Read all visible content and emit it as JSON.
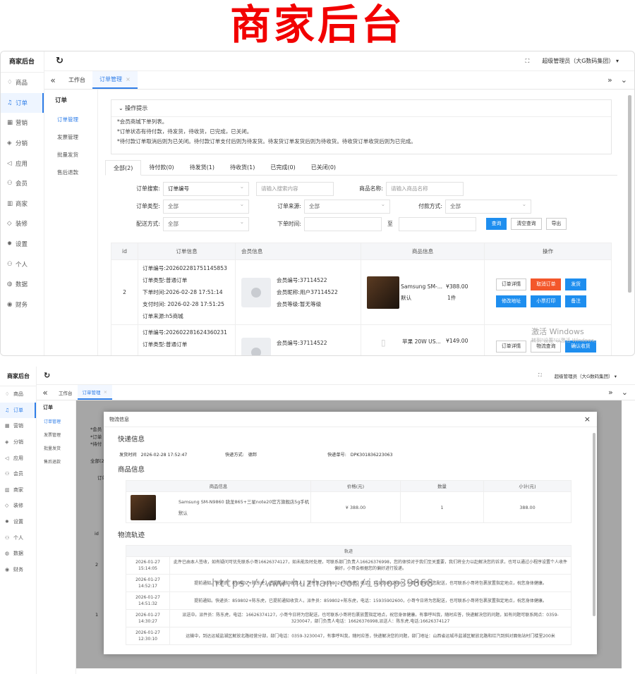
{
  "banner_title": "商家后台",
  "brand": "商家后台",
  "nav": [
    {
      "label": "商品",
      "icon": "diamond-icon"
    },
    {
      "label": "订单",
      "icon": "bell-icon",
      "active": true
    },
    {
      "label": "营销",
      "icon": "chart-icon"
    },
    {
      "label": "分销",
      "icon": "layers-icon"
    },
    {
      "label": "应用",
      "icon": "send-icon"
    },
    {
      "label": "会员",
      "icon": "user-icon"
    },
    {
      "label": "商家",
      "icon": "shop-icon"
    },
    {
      "label": "装修",
      "icon": "tag-icon"
    },
    {
      "label": "设置",
      "icon": "gear-icon"
    },
    {
      "label": "个人",
      "icon": "person-icon"
    },
    {
      "label": "数据",
      "icon": "globe-icon"
    },
    {
      "label": "财务",
      "icon": "money-icon"
    }
  ],
  "nav_icons": [
    "♢",
    "♫",
    "▦",
    "◈",
    "◁",
    "⚇",
    "▥",
    "◇",
    "✹",
    "⚇",
    "◍",
    "◉"
  ],
  "user": "超级管理员（大G数码集团）",
  "tabs": {
    "home": "工作台",
    "current": "订单管理",
    "close": "×"
  },
  "sub": {
    "heading": "订单",
    "items": [
      "订单管理",
      "发票管理",
      "批量发货",
      "售后退款"
    ]
  },
  "tips": {
    "title": "操作提示",
    "lines": [
      "*会员商城下单列表。",
      "*订单状态有待付款，待发货，待收货，已完成，已关闭。",
      "*待付款订单取消后则为已关闭。待付款订单支付后则为待发货。待发货订单发货后则为待收货。待收货订单收货后则为已完成。"
    ]
  },
  "status_tabs": [
    "全部(2)",
    "待付款(0)",
    "待发货(1)",
    "待收货(1)",
    "已完成(0)",
    "已关闭(0)"
  ],
  "filters": {
    "search_label": "订单搜索:",
    "search_type": "订单编号",
    "search_placeholder": "请输入搜索内容",
    "goods_label": "商品名称:",
    "goods_placeholder": "请输入商品名称",
    "type_label": "订单类型:",
    "type_value": "全部",
    "source_label": "订单来源:",
    "source_value": "全部",
    "pay_label": "付款方式:",
    "pay_value": "全部",
    "ship_label": "配送方式:",
    "ship_value": "全部",
    "time_label": "下单时间:",
    "to": "至",
    "query": "查询",
    "clear": "清空查询",
    "export": "导出"
  },
  "table": {
    "headers": [
      "id",
      "订单信息",
      "会员信息",
      "商品信息",
      "操作"
    ],
    "rows": [
      {
        "id": "2",
        "order": [
          "订单编号:202602281751145853",
          "订单类型:普通订单",
          "下单时间:2026-02-28 17:51:14",
          "支付时间: 2026-02-28 17:51:25",
          "订单来源:h5商城"
        ],
        "member": [
          "会员编号:37114522",
          "会员昵称:用户37114522",
          "会员等级:暂无等级"
        ],
        "goods_name": "Samsung SM-...",
        "goods_spec": "默认",
        "goods_price": "¥388.00",
        "goods_qty": "1件",
        "actions": [
          "订单详情",
          "取消订单",
          "发货",
          "修改地址",
          "小票打印",
          "备注"
        ]
      },
      {
        "id": "",
        "order": [
          "订单编号:202602281624360231",
          "订单类型:普通订单"
        ],
        "member": [
          "会员编号:37114522"
        ],
        "goods_name": "苹果 20W US...",
        "goods_price": "¥149.00",
        "actions": [
          "订单详情",
          "物流查询",
          "确认收货"
        ]
      }
    ]
  },
  "windows_wm": {
    "line1": "激活 Windows",
    "line2": "转到\"设置\"以激活 Windows。"
  },
  "modal": {
    "title": "物流信息",
    "close": "×",
    "express_section": "快递信息",
    "send_time_label": "发货时间",
    "send_time": "2026-02-28 17:52:47",
    "method_label": "快递方式:",
    "method": "德邦",
    "no_label": "快递单号:",
    "no": "DPK301836223063",
    "goods_section": "商品信息",
    "goods_headers": [
      "商品信息",
      "价格(元)",
      "数量",
      "小计(元)"
    ],
    "goods": {
      "name": "Samsung SM-N9860 骁龙865+三星note20官方旗舰店5g手机",
      "spec": "默认",
      "price": "¥ 388.00",
      "qty": "1",
      "subtotal": "388.00"
    },
    "track_section": "物流轨迹",
    "track_header": "轨迹",
    "tracks": [
      {
        "time": "2026-01-27 15:14:05",
        "text": "此件已由本人签收，如有疑问可优先联系小哥16626374127，如未能及时处理，可联系部门负责人16626376998，您的体验对于我们至关重要，我们将全力以赴解决您的诉求，也可以通过小程序设置个人收件偏好，小哥会根据您的偏好进行投递。"
      },
      {
        "time": "2026-01-27 14:52:17",
        "text": "提前通知。快递员：859802+陈东虎，已提前通知收货人，派件员：859802+陈东虎，电话：15935902600，小哥今日将为您配送，也可联系小哥将包裹放置指定地点，祝您身体健康。"
      },
      {
        "time": "2026-01-27 14:51:32",
        "text": "提前通知。快递员：859802+陈东虎，已提前通知收货人，派件员：859802+陈东虎，电话：15935902600，小哥今日将为您配送，也可联系小哥将包裹放置指定地点，祝您身体健康。"
      },
      {
        "time": "2026-01-27 14:30:27",
        "text": "派送中。派件员：陈东虎，电话：16626374127，小哥今日将为您配送，也可联系小哥将包裹放置指定地点，祝您身体健康。有事呼叫我，随时应答，快递解决您的问题，如有问题可联系网点：0359-3230047，部门负责人电话：16626376998,派送人：陈东虎,电话:16626374127"
      },
      {
        "time": "2026-01-27 12:30:10",
        "text": "运输中，到达运城盐湖区解放北路经营分部，部门电话：0359-3230047，有事呼叫我，随时应答，快递解决您的问题，部门地址：山西省运城市盐湖区解放北路和红汽到斜对面佑站村门楼里200米"
      }
    ]
  },
  "watermark": "https://www.huzhan.com/ishop39868",
  "bg2": {
    "tips_short": [
      "*会员",
      "*订单",
      "*待付"
    ],
    "all": "全部(2)",
    "order_short": "订单",
    "id_header": "id",
    "row_ids": [
      "2",
      "1"
    ]
  }
}
